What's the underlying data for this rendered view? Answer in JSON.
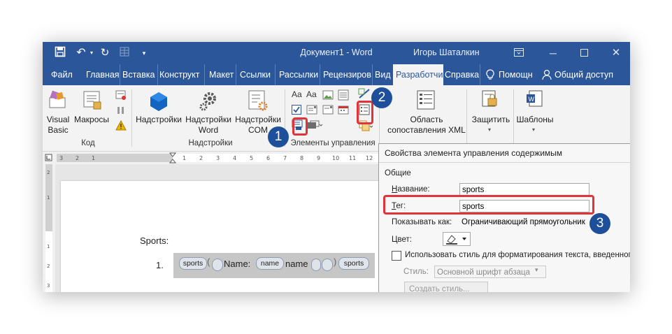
{
  "titlebar": {
    "document_title": "Документ1 - Word",
    "user_name": "Игорь Шаталкин",
    "restore_icon": "ribbon-display-icon",
    "minimize_icon": "minimize-icon",
    "maximize_icon": "maximize-icon",
    "close_icon": "close-icon"
  },
  "tabs": {
    "file": "Файл",
    "home": "Главная",
    "insert": "Вставка",
    "design": "Конструкт",
    "layout": "Макет",
    "references": "Ссылки",
    "mailings": "Рассылки",
    "review": "Рецензиров",
    "view": "Вид",
    "developer": "Разработчи",
    "help": "Справка",
    "tell_me": "Помощн",
    "share": "Общий доступ"
  },
  "ribbon": {
    "visual_basic_1": "Visual",
    "visual_basic_2": "Basic",
    "macros": "Макросы",
    "group_code": "Код",
    "addins_1": "Надстройки",
    "addins_word_1": "Надстройки",
    "addins_word_2": "Word",
    "addins_com_1": "Надстройки",
    "addins_com_2": "COM",
    "group_addins": "Надстройки",
    "aa1": "Aa",
    "aa2": "Aa",
    "group_controls": "Элементы управления",
    "mapping_1": "Область",
    "mapping_2": "сопоставления XML",
    "protect": "Защитить",
    "templates": "Шаблоны"
  },
  "document": {
    "sports_label": "Sports:",
    "list_number": "1.",
    "tag_sports_open": "sports",
    "name_text": "Name:",
    "tag_name": "name",
    "name_value": "name",
    "tag_sports_close": "sports"
  },
  "dialog": {
    "title": "Свойства элемента управления содержимым",
    "section_general": "Общие",
    "name_label": "Название:",
    "name_value": "sports",
    "tag_label": "Тег:",
    "tag_value": "sports",
    "show_as_label": "Показывать как:",
    "show_as_value": "Ограничивающий прямоугольник",
    "color_label": "Цвет:",
    "use_style_label": "Использовать стиль для форматирования текста, введенного",
    "style_label": "Стиль:",
    "style_value": "Основной шрифт абзаца",
    "create_style": "Создать стиль..."
  },
  "badges": {
    "one": "1",
    "two": "2",
    "three": "3"
  },
  "colors": {
    "accent": "#2b579a",
    "badge": "#1e4f9a",
    "highlight": "#e0333a"
  }
}
